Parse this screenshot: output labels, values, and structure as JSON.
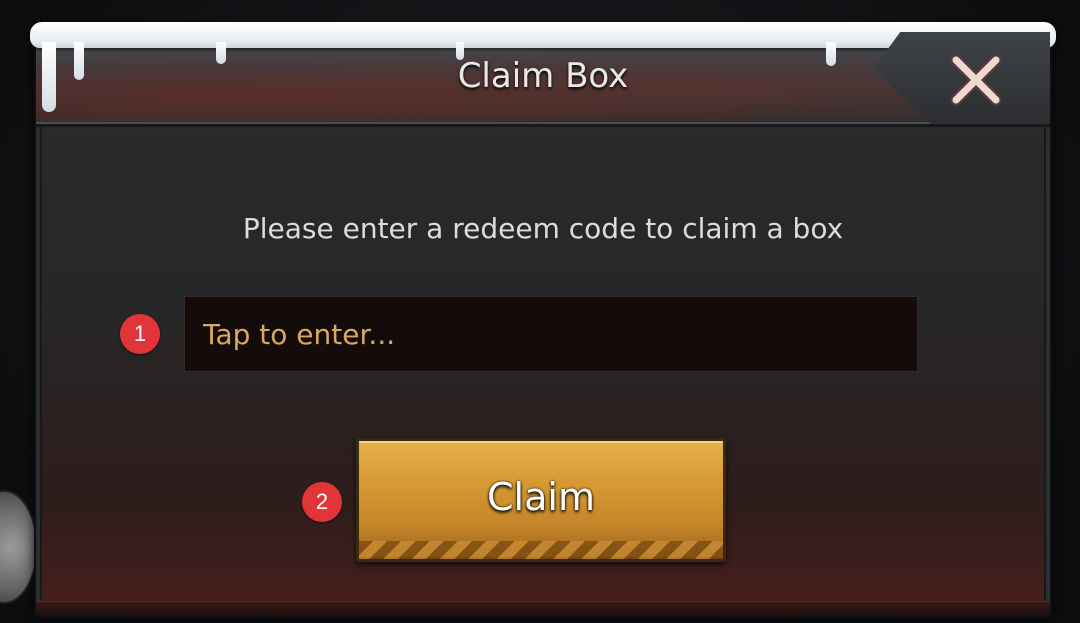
{
  "dialog": {
    "title": "Claim Box",
    "instruction": "Please enter a redeem code to claim a box",
    "close_icon": "close-x-icon"
  },
  "code_input": {
    "placeholder": "Tap to enter...",
    "value": ""
  },
  "claim_button": {
    "label": "Claim"
  },
  "markers": [
    {
      "label": "1"
    },
    {
      "label": "2"
    }
  ],
  "colors": {
    "accent_gold": "#d79a33",
    "placeholder_text": "#d9a860",
    "marker_red": "#e2353a"
  }
}
